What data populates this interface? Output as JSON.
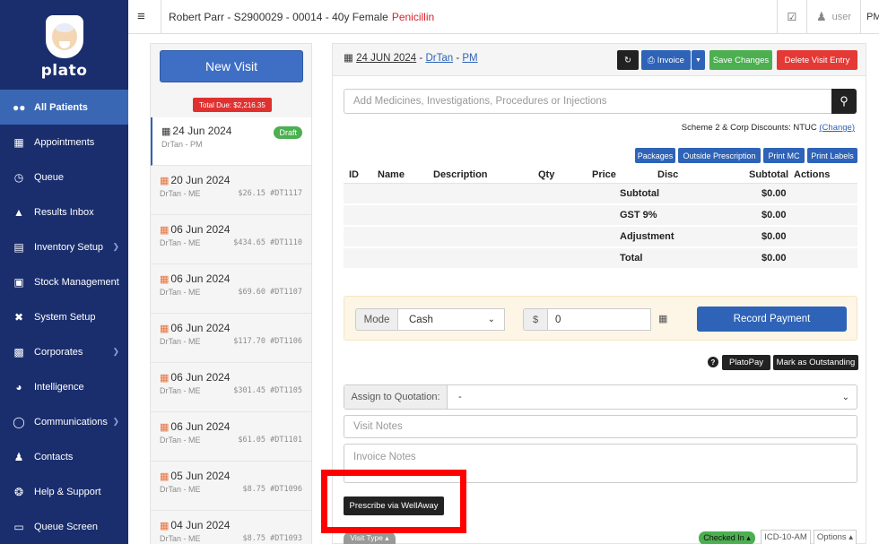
{
  "app": {
    "logo_text": "plato"
  },
  "sidebar": {
    "items": [
      {
        "label": "All Patients",
        "icon": "users-icon"
      },
      {
        "label": "Appointments",
        "icon": "calendar-icon"
      },
      {
        "label": "Queue",
        "icon": "clock-icon"
      },
      {
        "label": "Results Inbox",
        "icon": "flask-icon"
      },
      {
        "label": "Inventory Setup",
        "icon": "list-icon"
      },
      {
        "label": "Stock Management",
        "icon": "cart-icon"
      },
      {
        "label": "System Setup",
        "icon": "tools-icon"
      },
      {
        "label": "Corporates",
        "icon": "briefcase-icon"
      },
      {
        "label": "Intelligence",
        "icon": "pie-chart-icon"
      },
      {
        "label": "Communications",
        "icon": "chat-icon"
      },
      {
        "label": "Contacts",
        "icon": "contacts-icon"
      },
      {
        "label": "Help & Support",
        "icon": "lifebuoy-icon"
      },
      {
        "label": "Queue Screen",
        "icon": "monitor-icon"
      }
    ]
  },
  "topbar": {
    "patient": "Robert Parr - S2900029 - 00014 - 40y Female",
    "allergy": "Penicillin",
    "user": "user",
    "pm": "PM"
  },
  "visits": {
    "new_visit_label": "New Visit",
    "total_due": "Total Due: $2,216.35",
    "draft_label": "Draft",
    "items": [
      {
        "date": "24 Jun 2024",
        "doctor": "DrTan - PM",
        "amount": "",
        "ref": ""
      },
      {
        "date": "20 Jun 2024",
        "doctor": "DrTan - ME",
        "amount": "$26.15",
        "ref": "#DT1117"
      },
      {
        "date": "06 Jun 2024",
        "doctor": "DrTan - ME",
        "amount": "$434.65",
        "ref": "#DT1110"
      },
      {
        "date": "06 Jun 2024",
        "doctor": "DrTan - ME",
        "amount": "$69.60",
        "ref": "#DT1107"
      },
      {
        "date": "06 Jun 2024",
        "doctor": "DrTan - ME",
        "amount": "$117.70",
        "ref": "#DT1106"
      },
      {
        "date": "06 Jun 2024",
        "doctor": "DrTan - ME",
        "amount": "$301.45",
        "ref": "#DT1105"
      },
      {
        "date": "06 Jun 2024",
        "doctor": "DrTan - ME",
        "amount": "$61.05",
        "ref": "#DT1101"
      },
      {
        "date": "05 Jun 2024",
        "doctor": "DrTan - ME",
        "amount": "$8.75",
        "ref": "#DT1096"
      },
      {
        "date": "04 Jun 2024",
        "doctor": "DrTan - ME",
        "amount": "$8.75",
        "ref": "#DT1093"
      }
    ]
  },
  "main": {
    "visit_date": "24 JUN 2024",
    "visit_sep": " - ",
    "visit_doctor": "DrTan",
    "visit_mode": "PM",
    "invoice_label": "Invoice",
    "save_label": "Save Changes",
    "delete_label": "Delete Visit Entry",
    "search_placeholder": "Add Medicines, Investigations, Procedures or Injections",
    "scheme_text": "Scheme 2 & Corp Discounts: NTUC",
    "change_label": "(Change)",
    "packages_label": "Packages",
    "outside_label": "Outside Prescription",
    "printmc_label": "Print MC",
    "printlabels_label": "Print Labels",
    "table_headers": [
      "ID",
      "Name",
      "Description",
      "Qty",
      "Price",
      "Disc",
      "Subtotal",
      "Actions"
    ],
    "totals": [
      {
        "label": "Subtotal",
        "value": "$0.00"
      },
      {
        "label": "GST 9%",
        "value": "$0.00"
      },
      {
        "label": "Adjustment",
        "value": "$0.00"
      },
      {
        "label": "Total",
        "value": "$0.00"
      }
    ],
    "payment": {
      "mode_label": "Mode",
      "mode_value": "Cash",
      "currency": "$",
      "amount": "0",
      "record_label": "Record Payment"
    },
    "platopay_label": "PlatoPay",
    "outstanding_label": "Mark as Outstanding",
    "quotation_label": "Assign to Quotation:",
    "quotation_value": "-",
    "visit_notes_placeholder": "Visit Notes",
    "invoice_notes_placeholder": "Invoice Notes",
    "prescribe_label": "Prescribe via WellAway",
    "visit_type_label": "Visit Type ▴",
    "checked_in_label": "Checked In ▴",
    "icd_label": "ICD-10-AM",
    "options_label": "Options ▴"
  }
}
